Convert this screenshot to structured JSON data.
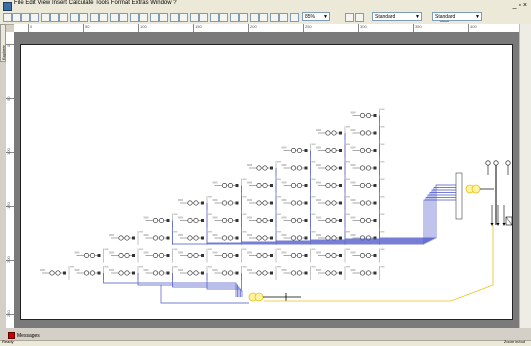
{
  "menu": {
    "items": [
      "File",
      "Edit",
      "View",
      "Insert",
      "Calculate",
      "Tools",
      "Format",
      "Extras",
      "Window",
      "?"
    ],
    "window_controls": "_ ▫ ×"
  },
  "toolbar": {
    "zoom_value": "85%",
    "style_combo_1": "Standard",
    "style_combo_2": "Standard"
  },
  "ruler": {
    "top_ticks": [
      "0",
      "50",
      "100",
      "150",
      "200",
      "250",
      "300",
      "350",
      "400",
      "450"
    ],
    "left_ticks": [
      "0",
      "50",
      "100",
      "150",
      "200",
      "250"
    ]
  },
  "side_tab": {
    "label": "Explorer"
  },
  "bottom": {
    "messages_tab": "Messages",
    "status_left": "Ready",
    "status_right": "Zoom in/out"
  },
  "colors": {
    "feeder_line": "#4a55c8",
    "link_line": "#e8c21c",
    "sheet_bg": "#ffffff",
    "canvas_bg": "#7a7a7a"
  },
  "diagram": {
    "rows": [
      {
        "count": 1
      },
      {
        "count": 2
      },
      {
        "count": 3
      },
      {
        "count": 4
      },
      {
        "count": 5
      },
      {
        "count": 6
      },
      {
        "count": 7
      },
      {
        "count": 8
      },
      {
        "count": 9
      },
      {
        "count": 10
      }
    ]
  }
}
